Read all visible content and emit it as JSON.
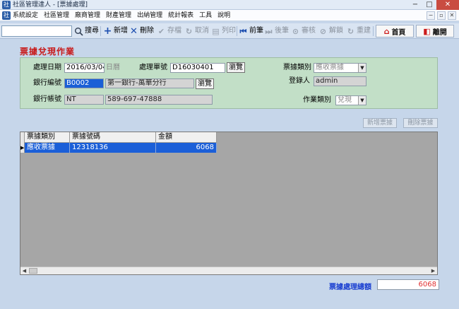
{
  "window": {
    "title": "社區管理達人 - [票據處理]",
    "icon": "社",
    "min": "−",
    "max": "□",
    "close": "✕"
  },
  "menu": {
    "icon": "社",
    "items": [
      "系統設定",
      "社區管理",
      "廠商管理",
      "財產管理",
      "出納管理",
      "統計報表",
      "工具",
      "說明"
    ],
    "mdi": [
      "−",
      "▫",
      "✕"
    ]
  },
  "toolbar": {
    "search_value": "",
    "search": "搜尋",
    "add": "新增",
    "delete": "刪除",
    "save": "存檔",
    "cancel": "取消",
    "print": "列印",
    "prev": "前筆",
    "next": "後筆",
    "audit": "審核",
    "unlock": "解鎖",
    "recompute": "重建",
    "home": "首頁",
    "exit": "離開"
  },
  "icons": {
    "search": "search-icon",
    "add": "plus-icon",
    "delete": "x-icon",
    "save": "check-icon",
    "cancel": "refresh-icon",
    "print": "printer-icon",
    "prev": "first-page-icon",
    "next": "next-page-icon",
    "audit": "lock-icon",
    "unlock": "unlock-icon",
    "recompute": "refresh-icon",
    "home": "home-icon",
    "exit": "exit-icon"
  },
  "page": {
    "title": "票據兌現作業"
  },
  "form": {
    "date_label": "處理日期",
    "date_value": "2016/03/04",
    "date_note": "日曆",
    "doc_label": "處理單號",
    "doc_value": "D16030401",
    "browse": "瀏覽",
    "type_label": "票據類別",
    "type_value": "應收票據",
    "bank_label": "銀行編號",
    "bank_code": "B0002",
    "bank_name": "第一銀行-萬華分行",
    "user_label": "登錄人",
    "user_value": "admin",
    "account_label": "銀行帳號",
    "account_type": "NT",
    "account_no": "589-697-47888",
    "job_label": "作業類別",
    "job_value": "兌現"
  },
  "grid": {
    "buttons": {
      "add": "新增票據",
      "delete": "刪除票據"
    },
    "columns": [
      "票據類別",
      "票據號碼",
      "金額"
    ],
    "rows": [
      {
        "indicator": "▶",
        "type": "應收票據",
        "number": "12318136",
        "amount": "6068"
      }
    ],
    "scroll_left": "◀",
    "scroll_right": "▶"
  },
  "total": {
    "label": "票據處理總額",
    "value": "6068"
  },
  "colors": {
    "title_red": "#c81b1b",
    "total_blue": "#1a3fd1",
    "selection": "#1b5fd8",
    "panel_green": "#c2dfc7",
    "background": "#c6d6ea"
  }
}
